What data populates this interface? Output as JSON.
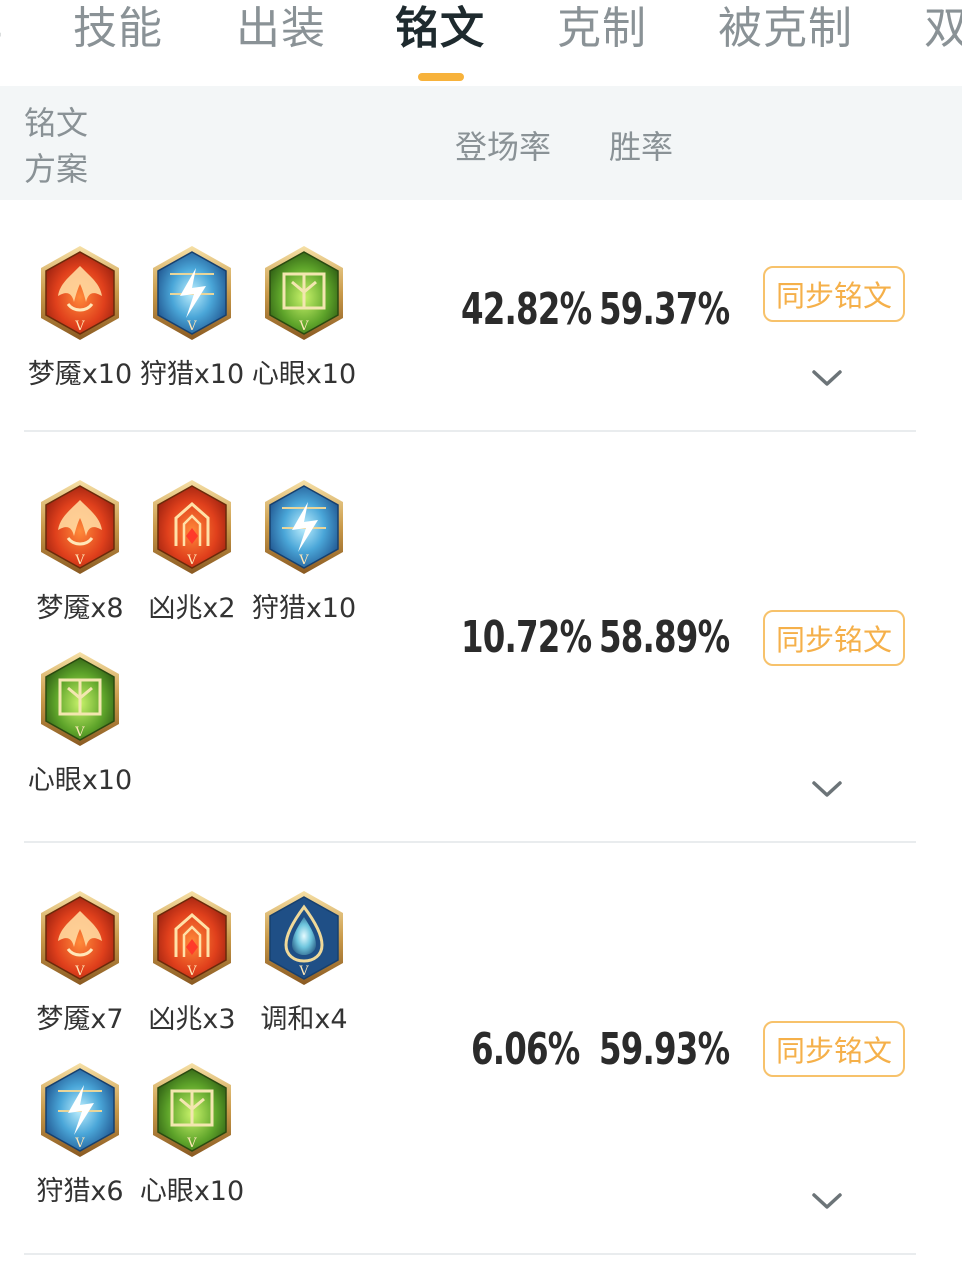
{
  "tabs": {
    "items": [
      "技能",
      "出装",
      "铭文",
      "克制",
      "被克制",
      "双"
    ],
    "active_index": 2
  },
  "header": {
    "plan_label": "铭文\n方案",
    "usage_label": "登场率",
    "win_label": "胜率"
  },
  "rows": [
    {
      "usage": "42.82%",
      "win": "59.37%",
      "sync_label": "同步铭文",
      "runes": [
        {
          "label": "梦魇x10",
          "icon": "red-mengyan-icon"
        },
        {
          "label": "狩猎x10",
          "icon": "blue-shoulie-icon"
        },
        {
          "label": "心眼x10",
          "icon": "green-xinyan-icon"
        }
      ]
    },
    {
      "usage": "10.72%",
      "win": "58.89%",
      "sync_label": "同步铭文",
      "runes": [
        {
          "label": "梦魇x8",
          "icon": "red-mengyan-icon"
        },
        {
          "label": "凶兆x2",
          "icon": "red-xiongzhao-icon"
        },
        {
          "label": "狩猎x10",
          "icon": "blue-shoulie-icon"
        },
        {
          "label": "心眼x10",
          "icon": "green-xinyan-icon"
        }
      ]
    },
    {
      "usage": "6.06%",
      "win": "59.93%",
      "sync_label": "同步铭文",
      "runes": [
        {
          "label": "梦魇x7",
          "icon": "red-mengyan-icon"
        },
        {
          "label": "凶兆x3",
          "icon": "red-xiongzhao-icon"
        },
        {
          "label": "调和x4",
          "icon": "blue-tiaohe-icon"
        },
        {
          "label": "狩猎x6",
          "icon": "blue-shoulie-icon"
        },
        {
          "label": "心眼x10",
          "icon": "green-xinyan-icon"
        }
      ]
    }
  ],
  "colors": {
    "accent": "#f7b23b",
    "button_text": "#f5b04a",
    "header_bg": "#f3f6f7",
    "muted_text": "#8a9296"
  }
}
